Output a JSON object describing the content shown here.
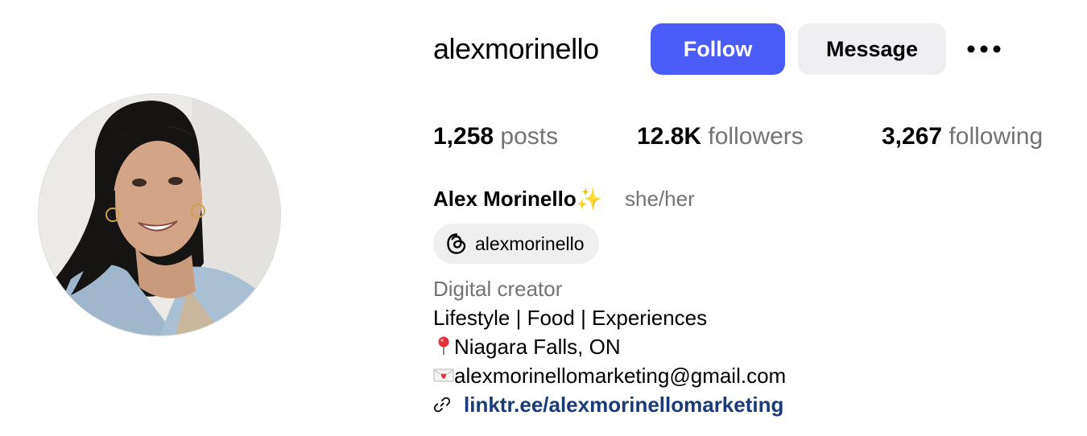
{
  "profile": {
    "username": "alexmorinello",
    "display_name": "Alex Morinello",
    "display_name_emoji": "✨",
    "pronouns": "she/her"
  },
  "actions": {
    "follow_label": "Follow",
    "message_label": "Message",
    "more_icon": "more-horizontal-icon"
  },
  "stats": {
    "posts_count": "1,258",
    "posts_label": "posts",
    "followers_count": "12.8K",
    "followers_label": "followers",
    "following_count": "3,267",
    "following_label": "following"
  },
  "threads": {
    "icon": "threads-icon",
    "handle": "alexmorinello"
  },
  "bio": {
    "category": "Digital creator",
    "line1": "Lifestyle | Food | Experiences",
    "line2": "Niagara Falls, ON",
    "line2_icon": "pushpin-icon",
    "line3": "alexmorinellomarketing@gmail.com",
    "line3_icon": "love-letter-icon"
  },
  "link": {
    "icon": "link-icon",
    "text": "linktr.ee/alexmorinellomarketing"
  },
  "colors": {
    "accent": "#4a5df9",
    "secondary_button": "#efeff2",
    "muted_text": "#737373",
    "link": "#1a3a7a"
  }
}
